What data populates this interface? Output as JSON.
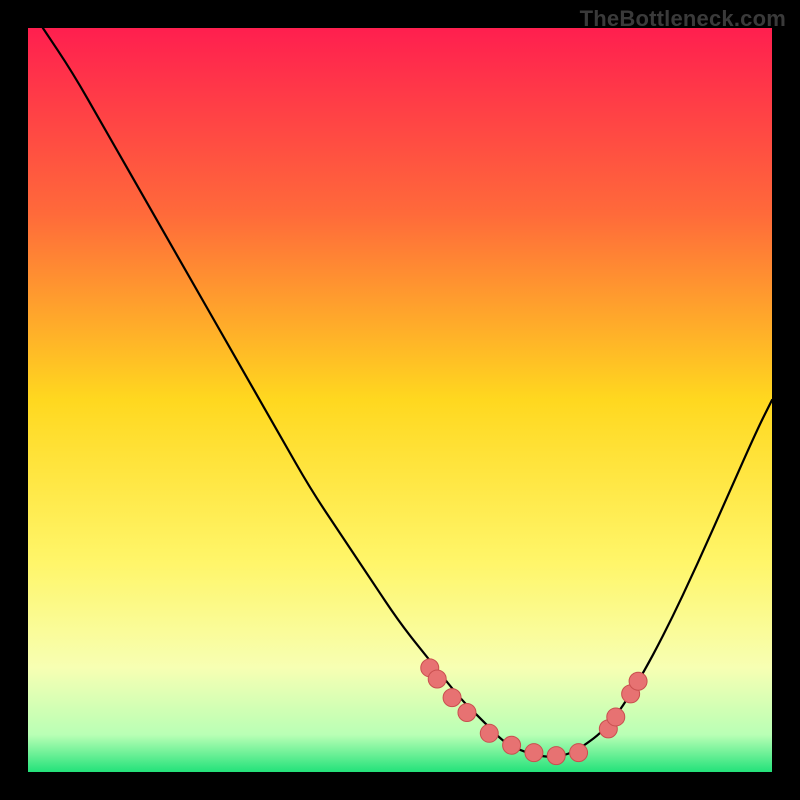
{
  "watermark": "TheBottleneck.com",
  "chart_data": {
    "type": "line",
    "title": "",
    "xlabel": "",
    "ylabel": "",
    "xlim": [
      0,
      100
    ],
    "ylim": [
      0,
      100
    ],
    "grid": false,
    "legend": false,
    "background_gradient_stops": [
      {
        "offset": 0.0,
        "color": "#ff1f4f"
      },
      {
        "offset": 0.25,
        "color": "#ff6a3a"
      },
      {
        "offset": 0.5,
        "color": "#ffd81f"
      },
      {
        "offset": 0.72,
        "color": "#fff66a"
      },
      {
        "offset": 0.86,
        "color": "#f7ffb3"
      },
      {
        "offset": 0.95,
        "color": "#b9ffb5"
      },
      {
        "offset": 1.0,
        "color": "#23e27a"
      }
    ],
    "series": [
      {
        "name": "bottleneck-curve",
        "stroke": "#000000",
        "stroke_width": 2.2,
        "x": [
          2,
          6,
          10,
          14,
          18,
          22,
          26,
          30,
          34,
          38,
          42,
          46,
          50,
          54,
          58,
          60,
          62,
          64,
          66,
          68,
          70,
          72,
          74,
          78,
          82,
          86,
          90,
          94,
          98,
          100
        ],
        "y": [
          100,
          94,
          87,
          80,
          73,
          66,
          59,
          52,
          45,
          38,
          32,
          26,
          20,
          15,
          10,
          8,
          6,
          4,
          3,
          2.3,
          2,
          2.2,
          3,
          6,
          12,
          19.5,
          28,
          37,
          46,
          50
        ]
      }
    ],
    "markers": {
      "name": "fit-points",
      "fill": "#e77272",
      "stroke": "#c94f4f",
      "r": 9,
      "x": [
        54,
        55,
        57,
        59,
        62,
        65,
        68,
        71,
        74,
        78,
        79,
        81,
        82
      ],
      "y": [
        14,
        12.5,
        10,
        8,
        5.2,
        3.6,
        2.6,
        2.2,
        2.6,
        5.8,
        7.4,
        10.5,
        12.2
      ]
    }
  }
}
